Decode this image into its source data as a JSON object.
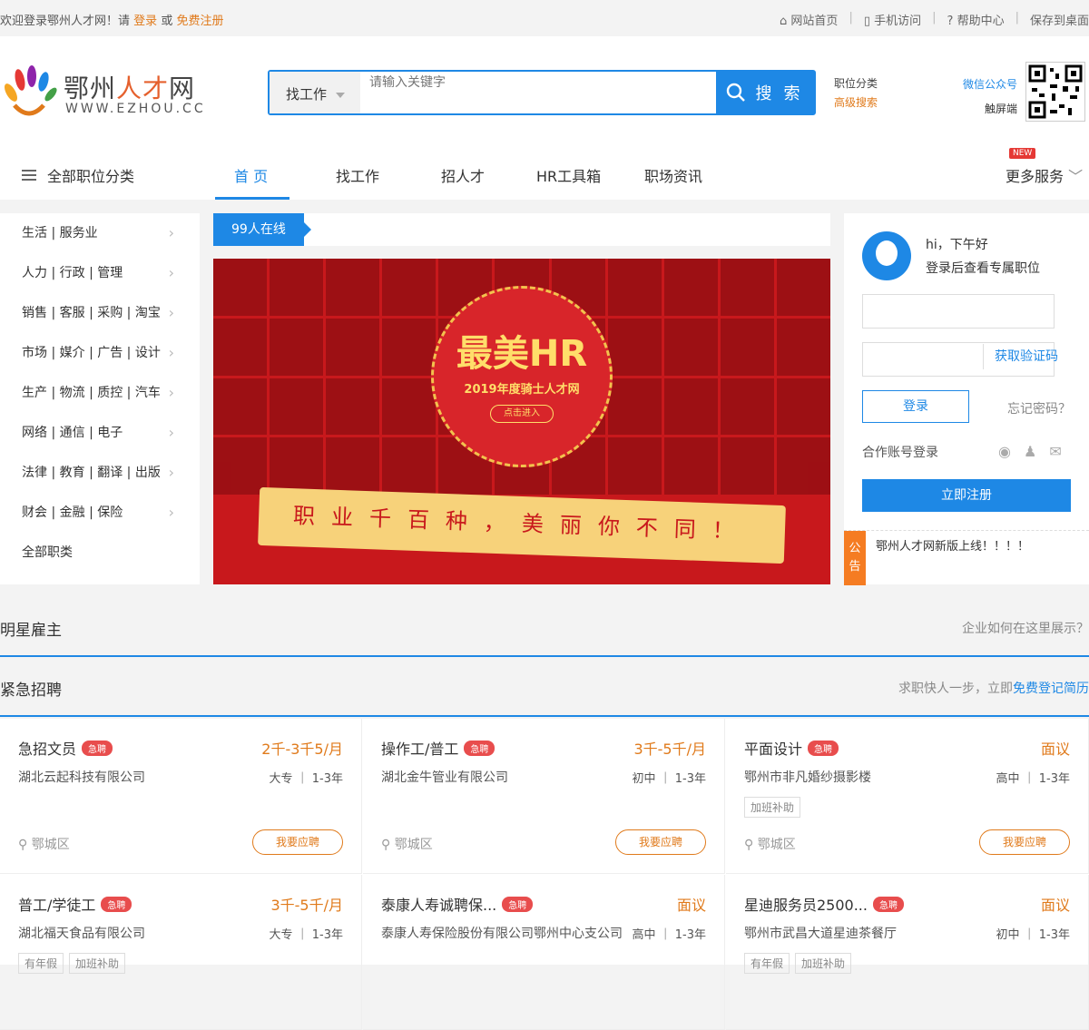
{
  "topbar": {
    "welcome": "欢迎登录鄂州人才网！请",
    "login": "登录",
    "or": "或",
    "register": "免费注册",
    "links": [
      "网站首页",
      "手机访问",
      "帮助中心",
      "保存到桌面"
    ]
  },
  "logo": {
    "name_a": "鄂州",
    "name_b": "人才",
    "name_c": "网",
    "domain": "WWW.EZHOU.CC"
  },
  "search": {
    "type": "找工作",
    "placeholder": "请输入关键字",
    "button": "搜 索"
  },
  "header_links": {
    "category": "职位分类",
    "advanced": "高级搜索"
  },
  "wechat": {
    "account": "微信公众号",
    "touch": "触屏端"
  },
  "nav": {
    "all": "全部职位分类",
    "items": [
      "首 页",
      "找工作",
      "招人才",
      "HR工具箱",
      "职场资讯"
    ],
    "more": "更多服务",
    "new": "NEW"
  },
  "categories": [
    "生活 | 服务业",
    "人力 | 行政 | 管理",
    "销售 | 客服 | 采购 | 淘宝",
    "市场 | 媒介 | 广告 | 设计",
    "生产 | 物流 | 质控 | 汽车",
    "网络 | 通信 | 电子",
    "法律 | 教育 | 翻译 | 出版",
    "财会 | 金融 | 保险",
    "全部职类"
  ],
  "online": "99人在线",
  "banner": {
    "headline": "最美HR",
    "year": "2019年度骑士人才网",
    "enter": "点击进入",
    "slogan": "职业千百种，美丽你不同！"
  },
  "user": {
    "greeting": "hi，下午好",
    "hint": "登录后查看专属职位",
    "get_code": "获取验证码",
    "login": "登录",
    "forgot": "忘记密码？",
    "coop": "合作账号登录",
    "register": "立即注册"
  },
  "notice": {
    "tag": "公告",
    "text": "鄂州人才网新版上线！！！！"
  },
  "star": {
    "title": "明星雇主",
    "link": "企业如何在这里展示？"
  },
  "urgent": {
    "title": "紧急招聘",
    "hint": "求职快人一步，立即",
    "link": "免费登记简历"
  },
  "jobs": [
    {
      "title": "急招文员",
      "badge": "急聘",
      "salary": "2千-3千5/月",
      "company": "湖北云起科技有限公司",
      "req": "大专 ｜ 1-3年",
      "tags": [],
      "loc": "鄂城区",
      "apply": "我要应聘"
    },
    {
      "title": "操作工/普工",
      "badge": "急聘",
      "salary": "3千-5千/月",
      "company": "湖北金牛管业有限公司",
      "req": "初中 ｜ 1-3年",
      "tags": [],
      "loc": "鄂城区",
      "apply": "我要应聘"
    },
    {
      "title": "平面设计",
      "badge": "急聘",
      "salary": "面议",
      "company": "鄂州市非凡婚纱摄影楼",
      "req": "高中 ｜ 1-3年",
      "tags": [
        "加班补助"
      ],
      "loc": "鄂城区",
      "apply": "我要应聘"
    },
    {
      "title": "普工/学徒工",
      "badge": "急聘",
      "salary": "3千-5千/月",
      "company": "湖北福天食品有限公司",
      "req": "大专 ｜ 1-3年",
      "tags": [
        "有年假",
        "加班补助"
      ],
      "loc": "",
      "apply": ""
    },
    {
      "title": "泰康人寿诚聘保...",
      "badge": "急聘",
      "salary": "面议",
      "company": "泰康人寿保险股份有限公司鄂州中心支公司",
      "req": "高中 ｜ 1-3年",
      "tags": [],
      "loc": "",
      "apply": ""
    },
    {
      "title": "星迪服务员2500...",
      "badge": "急聘",
      "salary": "面议",
      "company": "鄂州市武昌大道星迪茶餐厅",
      "req": "初中 ｜ 1-3年",
      "tags": [
        "有年假",
        "加班补助"
      ],
      "loc": "",
      "apply": ""
    }
  ],
  "colors": {
    "primary": "#1e88e5",
    "accent": "#e07a1b",
    "badge": "#e84d4d",
    "banner": "#c8181c"
  }
}
